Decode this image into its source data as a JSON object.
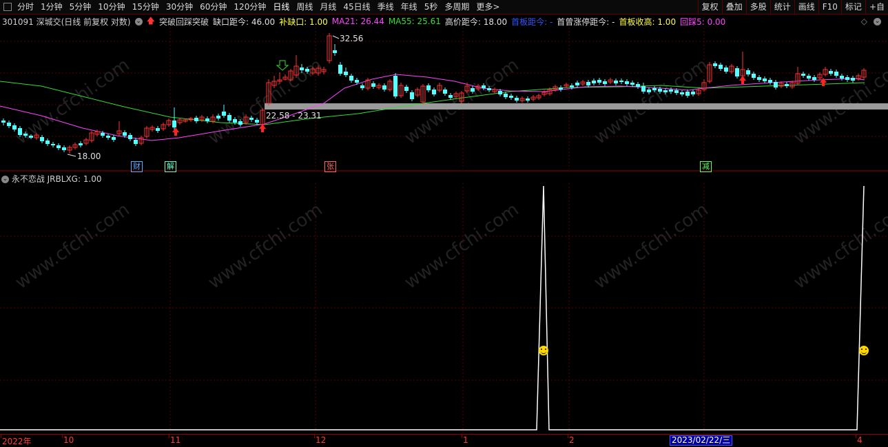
{
  "toolbar": {
    "periods": [
      "分时",
      "1分钟",
      "5分钟",
      "10分钟",
      "15分钟",
      "30分钟",
      "60分钟",
      "120分钟",
      "日线",
      "周线",
      "月线",
      "45日线",
      "季线",
      "年线",
      "5秒",
      "多周期",
      "更多>"
    ],
    "active_period": "日线",
    "right_buttons": [
      "复权",
      "叠加",
      "多股",
      "统计",
      "画线",
      "F10",
      "标记",
      "+自"
    ]
  },
  "info": {
    "stock": "301091 深城交(日线 前复权 对数)",
    "indicator_name": "突破回踩突破",
    "gap_distance": "缺口距今: 46.00",
    "fill_gap": "补缺口: 1.00",
    "ma21": "MA21: 26.44",
    "ma55": "MA55: 25.61",
    "high_distance": "高价距今: 18.00",
    "first_board_distance": "首板距今: -",
    "first_limit_distance": "首曾涨停距今: -",
    "first_board_close_high": "首板收高: 1.00",
    "pullback5": "回踩5: 0.00"
  },
  "price_labels": {
    "high": "32.56",
    "low": "18.00",
    "gap_range": "22.58 - 23.31"
  },
  "flags": [
    {
      "text": "财",
      "color": "#66aaff"
    },
    {
      "text": "解",
      "color": "#66ffcc"
    },
    {
      "text": "张",
      "color": "#ff6666"
    },
    {
      "text": "减",
      "color": "#66ff66"
    }
  ],
  "indicator": {
    "title": "永不恋战 JRBLXG: 1.00"
  },
  "dates": {
    "labels": [
      "2022年",
      "10",
      "11",
      "12",
      "1",
      "2",
      "4"
    ],
    "highlight": "2023/02/22/三"
  },
  "watermark": "www.cfchi.com",
  "colors": {
    "up": "#ff3333",
    "down": "#54ffff",
    "ma21": "#ff44ff",
    "ma55": "#33dd33",
    "indicator_line": "#ffffff",
    "gap_bar": "#9a9a9a"
  }
}
